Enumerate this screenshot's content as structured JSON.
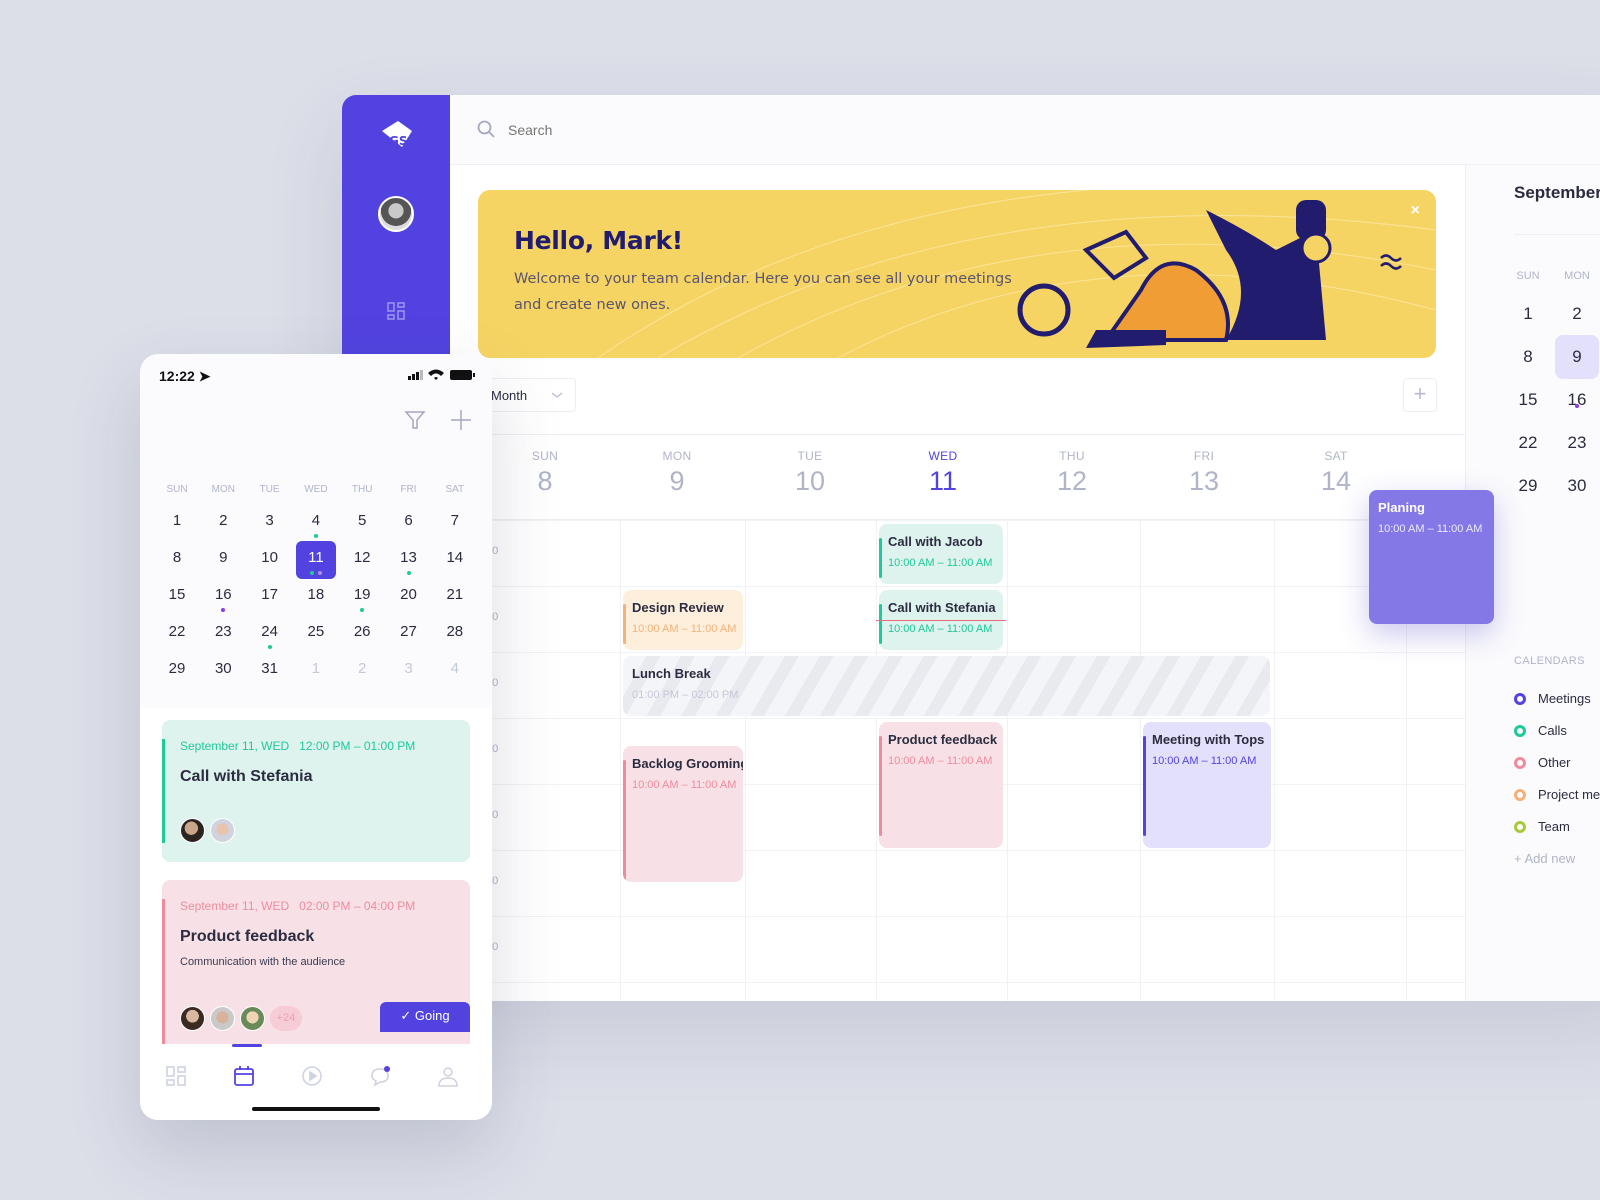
{
  "desktop": {
    "search": {
      "placeholder": "Search"
    },
    "banner": {
      "title": "Hello, Mark!",
      "text": "Welcome to your team calendar. Here you can see all your meetings and create new ones.",
      "close": "×"
    },
    "view_select": "Month",
    "add_label": "+",
    "week": [
      {
        "dn": "SUN",
        "dd": "8"
      },
      {
        "dn": "MON",
        "dd": "9"
      },
      {
        "dn": "TUE",
        "dd": "10"
      },
      {
        "dn": "WED",
        "dd": "11",
        "active": true
      },
      {
        "dn": "THU",
        "dd": "12"
      },
      {
        "dn": "FRI",
        "dd": "13"
      },
      {
        "dn": "SAT",
        "dd": "14"
      }
    ],
    "time_labels": [
      "00",
      "00",
      "00",
      "00",
      "00",
      "00",
      "00"
    ],
    "events": [
      {
        "title": "Call with Jacob",
        "time": "10:00 AM – 11:00 AM",
        "type": "call"
      },
      {
        "title": "Design Review",
        "time": "10:00 AM – 11:00 AM",
        "type": "project"
      },
      {
        "title": "Call with Stefania",
        "time": "10:00 AM – 11:00 AM",
        "type": "call"
      },
      {
        "title": "Lunch Break",
        "time": "01:00 PM – 02:00 PM",
        "type": "break"
      },
      {
        "title": "Backlog Grooming",
        "time": "10:00 AM – 11:00 AM",
        "type": "other"
      },
      {
        "title": "Product feedback",
        "time": "10:00 AM – 11:00 AM",
        "type": "other"
      },
      {
        "title": "Meeting with Tops",
        "time": "10:00 AM – 11:00 AM",
        "type": "meeting"
      },
      {
        "title": "Planing",
        "time": "10:00 AM – 11:00 AM",
        "type": "dragging"
      }
    ],
    "right_panel": {
      "month_title": "September",
      "day_names": [
        "SUN",
        "MON"
      ],
      "rows": [
        [
          "1",
          "2"
        ],
        [
          "8",
          "9"
        ],
        [
          "15",
          "16"
        ],
        [
          "22",
          "23"
        ],
        [
          "29",
          "30"
        ]
      ],
      "selected": "9",
      "calendars_heading": "CALENDARS",
      "calendars": [
        {
          "label": "Meetings",
          "color": "#5243e0"
        },
        {
          "label": "Calls",
          "color": "#1ec99b"
        },
        {
          "label": "Other",
          "color": "#ee8c9e"
        },
        {
          "label": "Project me",
          "color": "#f4b27a"
        },
        {
          "label": "Team",
          "color": "#a8c93a"
        }
      ],
      "add_new": "Add new"
    }
  },
  "mobile": {
    "status_time": "12:22",
    "day_names": [
      "SUN",
      "MON",
      "TUE",
      "WED",
      "THU",
      "FRI",
      "SAT"
    ],
    "weeks": [
      [
        "1",
        "2",
        "3",
        "4",
        "5",
        "6",
        "7"
      ],
      [
        "8",
        "9",
        "10",
        "11",
        "12",
        "13",
        "14"
      ],
      [
        "15",
        "16",
        "17",
        "18",
        "19",
        "20",
        "21"
      ],
      [
        "22",
        "23",
        "24",
        "25",
        "26",
        "27",
        "28"
      ],
      [
        "29",
        "30",
        "31",
        "1",
        "2",
        "3",
        "4"
      ]
    ],
    "selected": "11",
    "cards": [
      {
        "meta": "September 11, WED   12:00 PM – 01:00 PM",
        "title": "Call with Stefania"
      },
      {
        "meta": "September 11, WED   02:00 PM – 04:00 PM",
        "title": "Product feedback",
        "desc": "Communication with the audience",
        "more": "+24",
        "going": "✓ Going"
      }
    ]
  },
  "colors": {
    "brand": "#5243e0",
    "call": "#1ec99b",
    "other": "#ee8c9e",
    "project": "#f4b27a",
    "banner": "#f6d464"
  }
}
